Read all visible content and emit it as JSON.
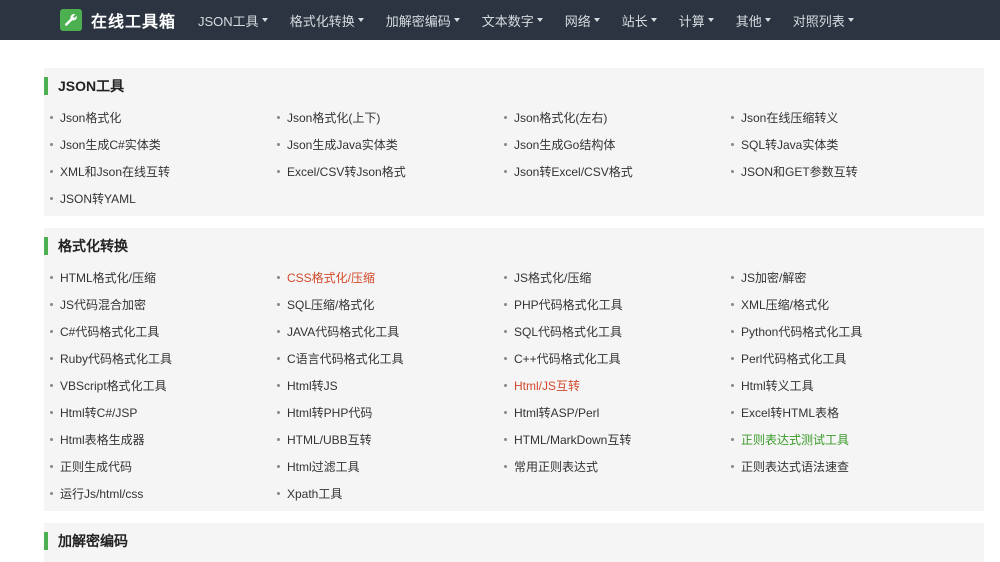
{
  "brand": {
    "title": "在线工具箱",
    "icon": "wrench-icon",
    "accent": "#4caf50"
  },
  "nav": [
    {
      "label": "JSON工具"
    },
    {
      "label": "格式化转换"
    },
    {
      "label": "加解密编码"
    },
    {
      "label": "文本数字"
    },
    {
      "label": "网络"
    },
    {
      "label": "站长"
    },
    {
      "label": "计算"
    },
    {
      "label": "其他"
    },
    {
      "label": "对照列表"
    }
  ],
  "sections": [
    {
      "title": "JSON工具",
      "links": [
        {
          "label": "Json格式化"
        },
        {
          "label": "Json格式化(上下)"
        },
        {
          "label": "Json格式化(左右)"
        },
        {
          "label": "Json在线压缩转义"
        },
        {
          "label": "Json生成C#实体类"
        },
        {
          "label": "Json生成Java实体类"
        },
        {
          "label": "Json生成Go结构体"
        },
        {
          "label": "SQL转Java实体类"
        },
        {
          "label": "XML和Json在线互转"
        },
        {
          "label": "Excel/CSV转Json格式"
        },
        {
          "label": "Json转Excel/CSV格式"
        },
        {
          "label": "JSON和GET参数互转"
        },
        {
          "label": "JSON转YAML"
        }
      ]
    },
    {
      "title": "格式化转换",
      "links": [
        {
          "label": "HTML格式化/压缩"
        },
        {
          "label": "CSS格式化/压缩",
          "color": "red"
        },
        {
          "label": "JS格式化/压缩"
        },
        {
          "label": "JS加密/解密"
        },
        {
          "label": "JS代码混合加密"
        },
        {
          "label": "SQL压缩/格式化"
        },
        {
          "label": "PHP代码格式化工具"
        },
        {
          "label": "XML压缩/格式化"
        },
        {
          "label": "C#代码格式化工具"
        },
        {
          "label": "JAVA代码格式化工具"
        },
        {
          "label": "SQL代码格式化工具"
        },
        {
          "label": "Python代码格式化工具"
        },
        {
          "label": "Ruby代码格式化工具"
        },
        {
          "label": "C语言代码格式化工具"
        },
        {
          "label": "C++代码格式化工具"
        },
        {
          "label": "Perl代码格式化工具"
        },
        {
          "label": "VBScript格式化工具"
        },
        {
          "label": "Html转JS"
        },
        {
          "label": "Html/JS互转",
          "color": "red"
        },
        {
          "label": "Html转义工具"
        },
        {
          "label": "Html转C#/JSP"
        },
        {
          "label": "Html转PHP代码"
        },
        {
          "label": "Html转ASP/Perl"
        },
        {
          "label": "Excel转HTML表格"
        },
        {
          "label": "Html表格生成器"
        },
        {
          "label": "HTML/UBB互转"
        },
        {
          "label": "HTML/MarkDown互转"
        },
        {
          "label": "正则表达式测试工具",
          "color": "green"
        },
        {
          "label": "正则生成代码"
        },
        {
          "label": "Html过滤工具"
        },
        {
          "label": "常用正则表达式"
        },
        {
          "label": "正则表达式语法速查"
        },
        {
          "label": "运行Js/html/css"
        },
        {
          "label": "Xpath工具"
        }
      ]
    },
    {
      "title": "加解密编码",
      "links": []
    }
  ]
}
